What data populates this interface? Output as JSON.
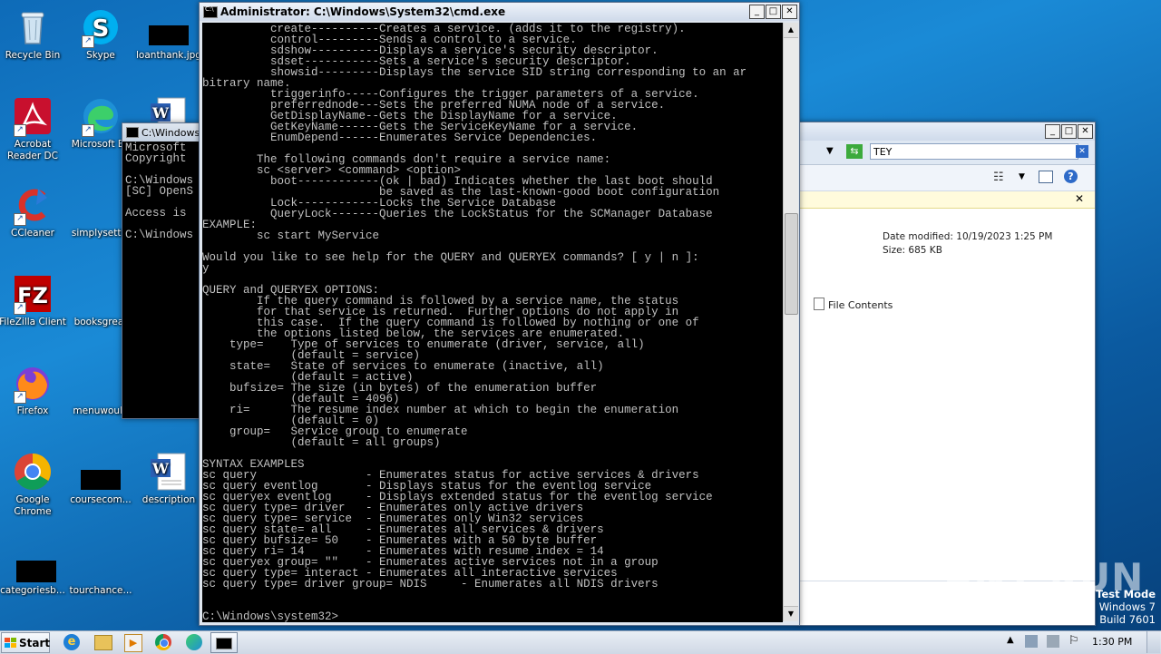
{
  "desktop": {
    "icons": [
      {
        "label": "Recycle Bin"
      },
      {
        "label": "Skype"
      },
      {
        "label": "loanthank.jpg"
      },
      {
        "label": "Acrobat\nReader DC"
      },
      {
        "label": "Microsoft Ed"
      },
      {
        "label": "CCleaner"
      },
      {
        "label": "simplysettin"
      },
      {
        "label": "FileZilla Client"
      },
      {
        "label": "booksgreat"
      },
      {
        "label": "Firefox"
      },
      {
        "label": "menuwould"
      },
      {
        "label": "Google\nChrome"
      },
      {
        "label": "coursecom..."
      },
      {
        "label": "description"
      },
      {
        "label": "categoriesb..."
      },
      {
        "label": "tourchance..."
      }
    ]
  },
  "cmd_small": {
    "title": "C:\\Windows",
    "text": "Microsoft\nCopyright\n\nC:\\Windows\n[SC] OpenS\n\nAccess is\n\nC:\\Windows"
  },
  "cmd_main": {
    "title": "Administrator: C:\\Windows\\System32\\cmd.exe",
    "text": "          create----------Creates a service. (adds it to the registry).\n          control---------Sends a control to a service.\n          sdshow----------Displays a service's security descriptor.\n          sdset-----------Sets a service's security descriptor.\n          showsid---------Displays the service SID string corresponding to an ar\nbitrary name.\n          triggerinfo-----Configures the trigger parameters of a service.\n          preferrednode---Sets the preferred NUMA node of a service.\n          GetDisplayName--Gets the DisplayName for a service.\n          GetKeyName------Gets the ServiceKeyName for a service.\n          EnumDepend------Enumerates Service Dependencies.\n\n        The following commands don't require a service name:\n        sc <server> <command> <option>\n          boot------------(ok | bad) Indicates whether the last boot should\n                          be saved as the last-known-good boot configuration\n          Lock------------Locks the Service Database\n          QueryLock-------Queries the LockStatus for the SCManager Database\nEXAMPLE:\n        sc start MyService\n\nWould you like to see help for the QUERY and QUERYEX commands? [ y | n ]:\ny\n\nQUERY and QUERYEX OPTIONS:\n        If the query command is followed by a service name, the status\n        for that service is returned.  Further options do not apply in\n        this case.  If the query command is followed by nothing or one of\n        the options listed below, the services are enumerated.\n    type=    Type of services to enumerate (driver, service, all)\n             (default = service)\n    state=   State of services to enumerate (inactive, all)\n             (default = active)\n    bufsize= The size (in bytes) of the enumeration buffer\n             (default = 4096)\n    ri=      The resume index number at which to begin the enumeration\n             (default = 0)\n    group=   Service group to enumerate\n             (default = all groups)\n\nSYNTAX EXAMPLES\nsc query                - Enumerates status for active services & drivers\nsc query eventlog       - Displays status for the eventlog service\nsc queryex eventlog     - Displays extended status for the eventlog service\nsc query type= driver   - Enumerates only active drivers\nsc query type= service  - Enumerates only Win32 services\nsc query state= all     - Enumerates all services & drivers\nsc query bufsize= 50    - Enumerates with a 50 byte buffer\nsc query ri= 14         - Enumerates with resume index = 14\nsc queryex group= \"\"    - Enumerates active services not in a group\nsc query type= interact - Enumerates all interactive services\nsc query type= driver group= NDIS     - Enumerates all NDIS drivers\n\n\nC:\\Windows\\system32>"
  },
  "explorer": {
    "search_value": "TEY",
    "date_modified": "Date modified: 10/19/2023 1:25 PM",
    "size": "Size: 685 KB",
    "file_contents": "File Contents"
  },
  "watermark": {
    "brand": "ANY RUN",
    "test_mode": "Test Mode",
    "os": "Windows 7",
    "build": "Build 7601"
  },
  "taskbar": {
    "start_label": "Start",
    "clock": "1:30 PM"
  },
  "colors": {
    "desktop": "#1a8ad6",
    "console_bg": "#000000",
    "console_fg": "#c0c0c0"
  }
}
